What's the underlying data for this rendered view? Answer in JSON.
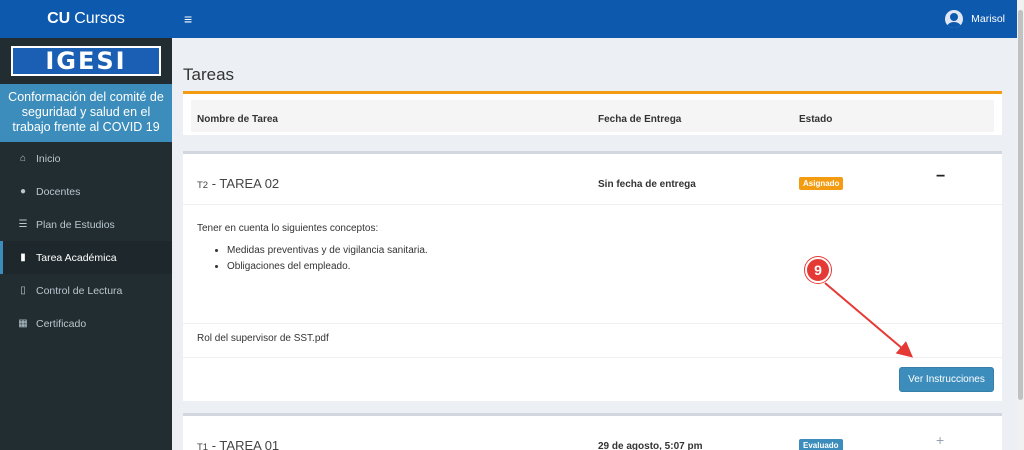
{
  "brand": {
    "bold": "CU",
    "rest": "Cursos"
  },
  "logo": {
    "text": "IGESI"
  },
  "course": {
    "title": "Conformación del comité de seguridad y salud en el trabajo frente al COVID 19"
  },
  "nav": {
    "items": [
      {
        "label": "Inicio",
        "icon": "home-icon"
      },
      {
        "label": "Docentes",
        "icon": "user-icon"
      },
      {
        "label": "Plan de Estudios",
        "icon": "list-icon"
      },
      {
        "label": "Tarea Académica",
        "icon": "document-icon"
      },
      {
        "label": "Control de Lectura",
        "icon": "book-icon"
      },
      {
        "label": "Certificado",
        "icon": "qr-icon"
      }
    ],
    "active": "Tarea Académica"
  },
  "topbar": {
    "menu_icon": "≡",
    "user_name": "Marisol"
  },
  "page": {
    "title": "Tareas"
  },
  "table_header": {
    "name": "Nombre de Tarea",
    "date": "Fecha de Entrega",
    "state": "Estado"
  },
  "tasks": [
    {
      "code": "T2",
      "name": "- TAREA 02",
      "date": "Sin fecha de entrega",
      "status": "Asignado",
      "toggle": "−",
      "intro": "Tener en cuenta lo siguientes conceptos:",
      "bullets": [
        "Medidas preventivas y de vigilancia sanitaria.",
        "Obligaciones del empleado."
      ],
      "attachment": "Rol del supervisor de SST.pdf",
      "button": "Ver Instrucciones"
    },
    {
      "code": "T1",
      "name": "- TAREA 01",
      "date": "29 de agosto, 5:07 pm",
      "status": "Evaluado",
      "toggle": "+"
    }
  ],
  "annotation": {
    "number": "9"
  },
  "colors": {
    "topbar": "#0d59ad",
    "sidebar": "#222d32",
    "accent": "#3c8dbc",
    "warning": "#f39c12",
    "annotation": "#e53935"
  }
}
